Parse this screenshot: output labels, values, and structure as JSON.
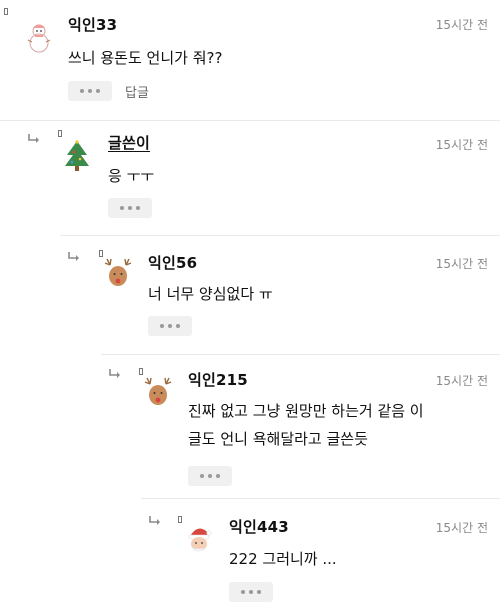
{
  "comments": [
    {
      "nickname": "익인33",
      "time": "15시간 전",
      "lines": [
        "쓰니 용돈도 언니가 줘??"
      ],
      "avatar": "snowman-avatar",
      "reply_label": "답글"
    },
    {
      "nickname": "글쓴이",
      "time": "15시간 전",
      "lines": [
        "응 ㅜㅜ"
      ],
      "avatar": "christmas-tree-avatar",
      "is_author": true
    },
    {
      "nickname": "익인56",
      "time": "15시간 전",
      "lines": [
        "너 너무 양심없다 ㅠ"
      ],
      "avatar": "reindeer-avatar"
    },
    {
      "nickname": "익인215",
      "time": "15시간 전",
      "lines": [
        "진짜 없고 그냥 원망만 하는거 같음 이",
        "글도 언니 욕해달라고 글쓴듯"
      ],
      "avatar": "reindeer-avatar"
    },
    {
      "nickname": "익인443",
      "time": "15시간 전",
      "lines": [
        "222 그러니까 ..."
      ],
      "avatar": "santa-avatar"
    }
  ],
  "colors": {
    "text": "#111111",
    "time": "#8a8a8a",
    "more_button_bg": "#f0f0f0",
    "separator": "#e9e9e9"
  },
  "icons": {
    "reply_indent": "reply-arrow-icon",
    "more": "more-dots-icon"
  }
}
